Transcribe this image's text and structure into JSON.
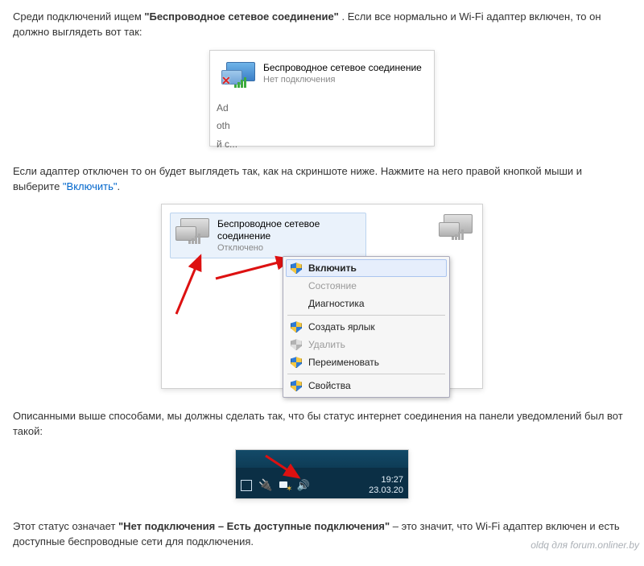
{
  "para1": {
    "a": "Среди подключений ищем ",
    "b": "\"Беспроводное сетевое соединение\"",
    "c": ". Если все нормально и Wi-Fi адаптер включен, то он должно выглядеть вот так:"
  },
  "ss1": {
    "title": "Беспроводное сетевое соединение",
    "status": "Нет подключения",
    "clip1": "Ad",
    "clip2": "oth",
    "clip3": "й c..."
  },
  "para2": {
    "a": "Если адаптер отключен то он будет выглядеть так, как на скриншоте ниже. Нажмите на него правой кнопкой мыши и выберите ",
    "link": "\"Включить\"",
    "c": "."
  },
  "ss2": {
    "conn_title": "Беспроводное сетевое соединение",
    "conn_status": "Отключено",
    "menu": {
      "enable": "Включить",
      "state": "Состояние",
      "diag": "Диагностика",
      "shortcut": "Создать ярлык",
      "delete": "Удалить",
      "rename": "Переименовать",
      "props": "Свойства"
    }
  },
  "para3": "Описанными выше способами,  мы должны сделать так, что бы статус интернет соединения на панели уведомлений был вот такой:",
  "ss3": {
    "time": "19:27",
    "date": "23.03.20"
  },
  "para4": {
    "a": "Этот статус означает ",
    "b": "\"Нет подключения – Есть доступные подключения\"",
    "c": " – это значит, что Wi-Fi адаптер включен и есть доступные беспроводные сети для подключения."
  },
  "watermark": "oldq для forum.onliner.by"
}
